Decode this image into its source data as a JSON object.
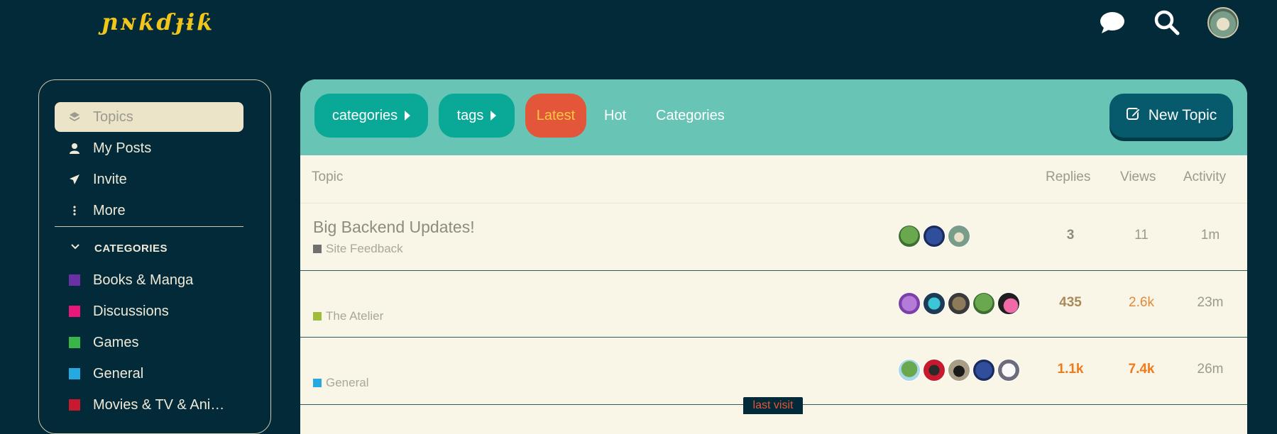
{
  "header": {
    "logo_text": "ɲɴƙɗɟɨƙ",
    "chat_icon": "chat-bubble-icon",
    "search_icon": "search-icon",
    "avatar": "user-avatar"
  },
  "sidebar": {
    "items": [
      {
        "label": "Topics",
        "icon": "layers-icon",
        "active": true
      },
      {
        "label": "My Posts",
        "icon": "user-icon"
      },
      {
        "label": "Invite",
        "icon": "paper-plane-icon"
      },
      {
        "label": "More",
        "icon": "vertical-ellipsis-icon"
      }
    ],
    "categories_heading": "CATEGORIES",
    "categories": [
      {
        "label": "Books & Manga",
        "color": "#6b2fa6"
      },
      {
        "label": "Discussions",
        "color": "#e8177a"
      },
      {
        "label": "Games",
        "color": "#3ab54a"
      },
      {
        "label": "General",
        "color": "#25a9e0"
      },
      {
        "label": "Movies & TV & Ani…",
        "color": "#c8192e"
      }
    ]
  },
  "navbar": {
    "categories_label": "categories",
    "tags_label": "tags",
    "tabs": [
      "Latest",
      "Hot",
      "Categories"
    ],
    "active_tab": "Latest",
    "new_topic_label": "New Topic",
    "colors": {
      "bar": "#68c5b6",
      "pill": "#0aa896",
      "active": "#e4563a",
      "new_topic": "#075a6b"
    }
  },
  "table": {
    "headers": {
      "topic": "Topic",
      "replies": "Replies",
      "views": "Views",
      "activity": "Activity"
    },
    "rows": [
      {
        "title": "Big Backend Updates!",
        "category": "Site Feedback",
        "category_color": "#707070",
        "replies": "3",
        "views": "11",
        "activity": "1m"
      },
      {
        "title": "",
        "category": "The Atelier",
        "category_color": "#9fbc3a",
        "replies": "435",
        "views": "2.6k",
        "activity": "23m"
      },
      {
        "title": "",
        "category": "General",
        "category_color": "#25a9e0",
        "replies": "1.1k",
        "views": "7.4k",
        "activity": "26m"
      }
    ]
  },
  "last_visit_label": "last visit"
}
